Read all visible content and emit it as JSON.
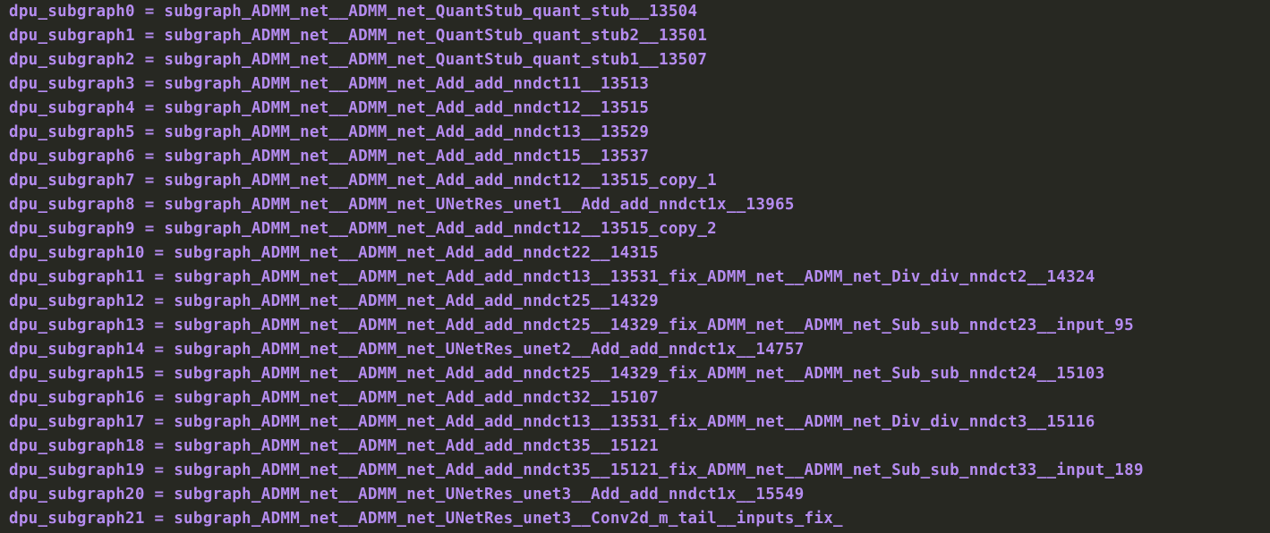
{
  "terminal": {
    "text_color": "#b58cf0",
    "background": "#272822",
    "lines": [
      "dpu_subgraph0 = subgraph_ADMM_net__ADMM_net_QuantStub_quant_stub__13504",
      "dpu_subgraph1 = subgraph_ADMM_net__ADMM_net_QuantStub_quant_stub2__13501",
      "dpu_subgraph2 = subgraph_ADMM_net__ADMM_net_QuantStub_quant_stub1__13507",
      "dpu_subgraph3 = subgraph_ADMM_net__ADMM_net_Add_add_nndct11__13513",
      "dpu_subgraph4 = subgraph_ADMM_net__ADMM_net_Add_add_nndct12__13515",
      "dpu_subgraph5 = subgraph_ADMM_net__ADMM_net_Add_add_nndct13__13529",
      "dpu_subgraph6 = subgraph_ADMM_net__ADMM_net_Add_add_nndct15__13537",
      "dpu_subgraph7 = subgraph_ADMM_net__ADMM_net_Add_add_nndct12__13515_copy_1",
      "dpu_subgraph8 = subgraph_ADMM_net__ADMM_net_UNetRes_unet1__Add_add_nndct1x__13965",
      "dpu_subgraph9 = subgraph_ADMM_net__ADMM_net_Add_add_nndct12__13515_copy_2",
      "dpu_subgraph10 = subgraph_ADMM_net__ADMM_net_Add_add_nndct22__14315",
      "dpu_subgraph11 = subgraph_ADMM_net__ADMM_net_Add_add_nndct13__13531_fix_ADMM_net__ADMM_net_Div_div_nndct2__14324",
      "dpu_subgraph12 = subgraph_ADMM_net__ADMM_net_Add_add_nndct25__14329",
      "dpu_subgraph13 = subgraph_ADMM_net__ADMM_net_Add_add_nndct25__14329_fix_ADMM_net__ADMM_net_Sub_sub_nndct23__input_95",
      "dpu_subgraph14 = subgraph_ADMM_net__ADMM_net_UNetRes_unet2__Add_add_nndct1x__14757",
      "dpu_subgraph15 = subgraph_ADMM_net__ADMM_net_Add_add_nndct25__14329_fix_ADMM_net__ADMM_net_Sub_sub_nndct24__15103",
      "dpu_subgraph16 = subgraph_ADMM_net__ADMM_net_Add_add_nndct32__15107",
      "dpu_subgraph17 = subgraph_ADMM_net__ADMM_net_Add_add_nndct13__13531_fix_ADMM_net__ADMM_net_Div_div_nndct3__15116",
      "dpu_subgraph18 = subgraph_ADMM_net__ADMM_net_Add_add_nndct35__15121",
      "dpu_subgraph19 = subgraph_ADMM_net__ADMM_net_Add_add_nndct35__15121_fix_ADMM_net__ADMM_net_Sub_sub_nndct33__input_189",
      "dpu_subgraph20 = subgraph_ADMM_net__ADMM_net_UNetRes_unet3__Add_add_nndct1x__15549",
      "dpu_subgraph21 = subgraph_ADMM_net__ADMM_net_UNetRes_unet3__Conv2d_m_tail__inputs_fix_"
    ]
  }
}
